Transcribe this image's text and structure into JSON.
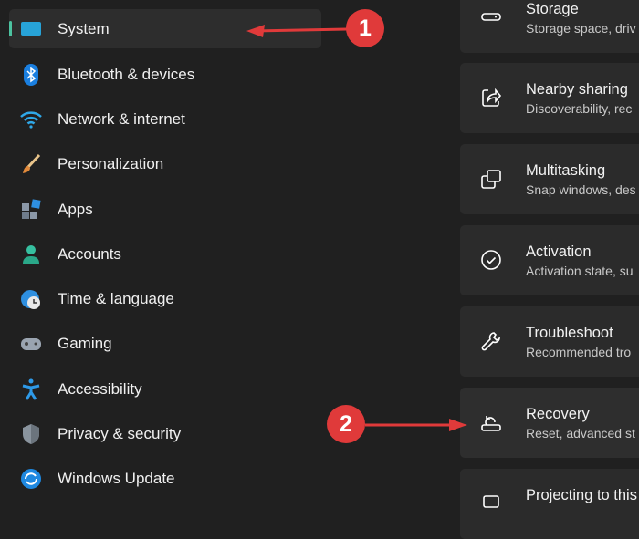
{
  "sidebar": {
    "items": [
      {
        "label": "System",
        "icon": "monitor-icon",
        "selected": true
      },
      {
        "label": "Bluetooth & devices",
        "icon": "bluetooth-icon"
      },
      {
        "label": "Network & internet",
        "icon": "wifi-icon"
      },
      {
        "label": "Personalization",
        "icon": "brush-icon"
      },
      {
        "label": "Apps",
        "icon": "apps-icon"
      },
      {
        "label": "Accounts",
        "icon": "person-icon"
      },
      {
        "label": "Time & language",
        "icon": "globe-clock-icon"
      },
      {
        "label": "Gaming",
        "icon": "gamepad-icon"
      },
      {
        "label": "Accessibility",
        "icon": "accessibility-icon"
      },
      {
        "label": "Privacy & security",
        "icon": "shield-icon"
      },
      {
        "label": "Windows Update",
        "icon": "update-icon"
      }
    ]
  },
  "cards": [
    {
      "title": "Storage",
      "subtitle": "Storage space, driv",
      "icon": "drive-icon"
    },
    {
      "title": "Nearby sharing",
      "subtitle": "Discoverability, rec",
      "icon": "share-icon"
    },
    {
      "title": "Multitasking",
      "subtitle": "Snap windows, des",
      "icon": "multitask-icon"
    },
    {
      "title": "Activation",
      "subtitle": "Activation state, su",
      "icon": "check-circle-icon"
    },
    {
      "title": "Troubleshoot",
      "subtitle": "Recommended tro",
      "icon": "wrench-icon"
    },
    {
      "title": "Recovery",
      "subtitle": "Reset, advanced st",
      "icon": "recovery-icon"
    },
    {
      "title": "Projecting to this PC",
      "subtitle": "",
      "icon": "project-icon"
    }
  ],
  "annotations": {
    "one": "1",
    "two": "2",
    "color": "#e03a3a"
  }
}
